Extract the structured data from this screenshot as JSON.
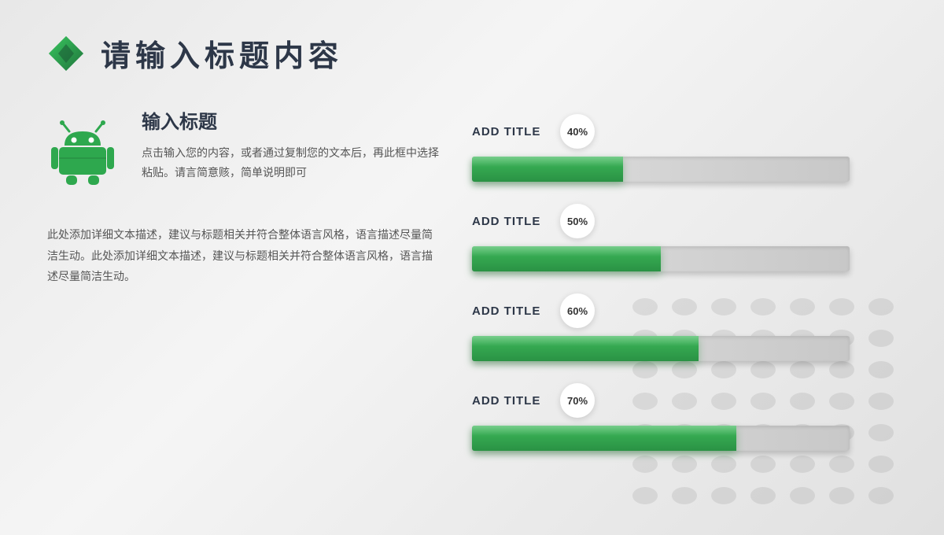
{
  "page": {
    "title": "请输入标题内容",
    "background": "#e8e8e8"
  },
  "header": {
    "title": "请输入标题内容"
  },
  "left": {
    "card": {
      "title": "输入标题",
      "description": "点击输入您的内容，或者通过复制您的文本后，再此框中选择粘贴。请言简意赅，简单说明即可"
    },
    "description": "此处添加详细文本描述，建议与标题相关并符合整体语言风格，语言描述尽量简洁生动。此处添加详细文本描述，建议与标题相关并符合整体语言风格，语言描述尽量简洁生动。"
  },
  "bars": [
    {
      "label": "ADD TITLE",
      "percent": 40,
      "percentLabel": "40%"
    },
    {
      "label": "ADD TITLE",
      "percent": 50,
      "percentLabel": "50%"
    },
    {
      "label": "ADD TITLE",
      "percent": 60,
      "percentLabel": "60%"
    },
    {
      "label": "ADD TITLE",
      "percent": 70,
      "percentLabel": "70%"
    }
  ],
  "colors": {
    "accent": "#2ea84e",
    "title": "#2d3748",
    "text": "#555555",
    "diamond1": "#2ea84e",
    "diamond2": "#1a5c35"
  }
}
